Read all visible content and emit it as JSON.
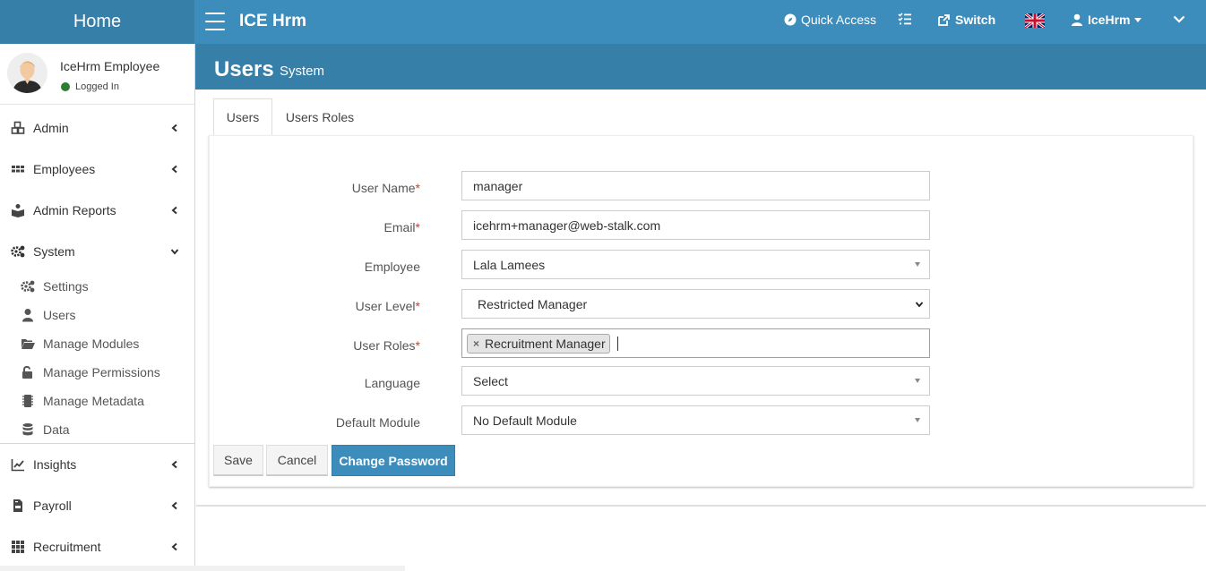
{
  "header": {
    "home_label": "Home",
    "app_title": "ICE Hrm",
    "quick_access": "Quick Access",
    "switch_label": "Switch",
    "user_label": "IceHrm"
  },
  "page": {
    "title": "Users",
    "subtitle": "System"
  },
  "sidebar": {
    "user_name": "IceHrm Employee",
    "status": "Logged In",
    "items": [
      {
        "label": "Admin",
        "icon": "cubes-icon"
      },
      {
        "label": "Employees",
        "icon": "th-icon"
      },
      {
        "label": "Admin Reports",
        "icon": "book-reader-icon"
      },
      {
        "label": "System",
        "icon": "cogs-icon"
      },
      {
        "label": "Insights",
        "icon": "chart-line-icon"
      },
      {
        "label": "Payroll",
        "icon": "file-invoice-icon"
      },
      {
        "label": "Recruitment",
        "icon": "th-grid-icon"
      }
    ],
    "system_items": [
      {
        "label": "Settings",
        "icon": "cogs-icon"
      },
      {
        "label": "Users",
        "icon": "user-icon"
      },
      {
        "label": "Manage Modules",
        "icon": "folder-open-icon"
      },
      {
        "label": "Manage Permissions",
        "icon": "unlock-icon"
      },
      {
        "label": "Manage Metadata",
        "icon": "microchip-icon"
      },
      {
        "label": "Data",
        "icon": "database-icon"
      }
    ]
  },
  "tabs": [
    "Users",
    "Users Roles"
  ],
  "form": {
    "user_name": {
      "label": "User Name",
      "value": "manager",
      "required": true
    },
    "email": {
      "label": "Email",
      "value": "icehrm+manager@web-stalk.com",
      "required": true
    },
    "employee": {
      "label": "Employee",
      "value": "Lala Lamees"
    },
    "user_level": {
      "label": "User Level",
      "value": "Restricted Manager",
      "required": true
    },
    "user_roles": {
      "label": "User Roles",
      "chip": "Recruitment Manager",
      "required": true
    },
    "language": {
      "label": "Language",
      "value": "Select"
    },
    "default_module": {
      "label": "Default Module",
      "value": "No Default Module"
    },
    "required_mark": "*"
  },
  "buttons": {
    "save": "Save",
    "cancel": "Cancel",
    "change_password": "Change Password"
  },
  "colors": {
    "header": "#3c8dbc",
    "header_dark": "#367fa9",
    "required": "#d73925"
  }
}
